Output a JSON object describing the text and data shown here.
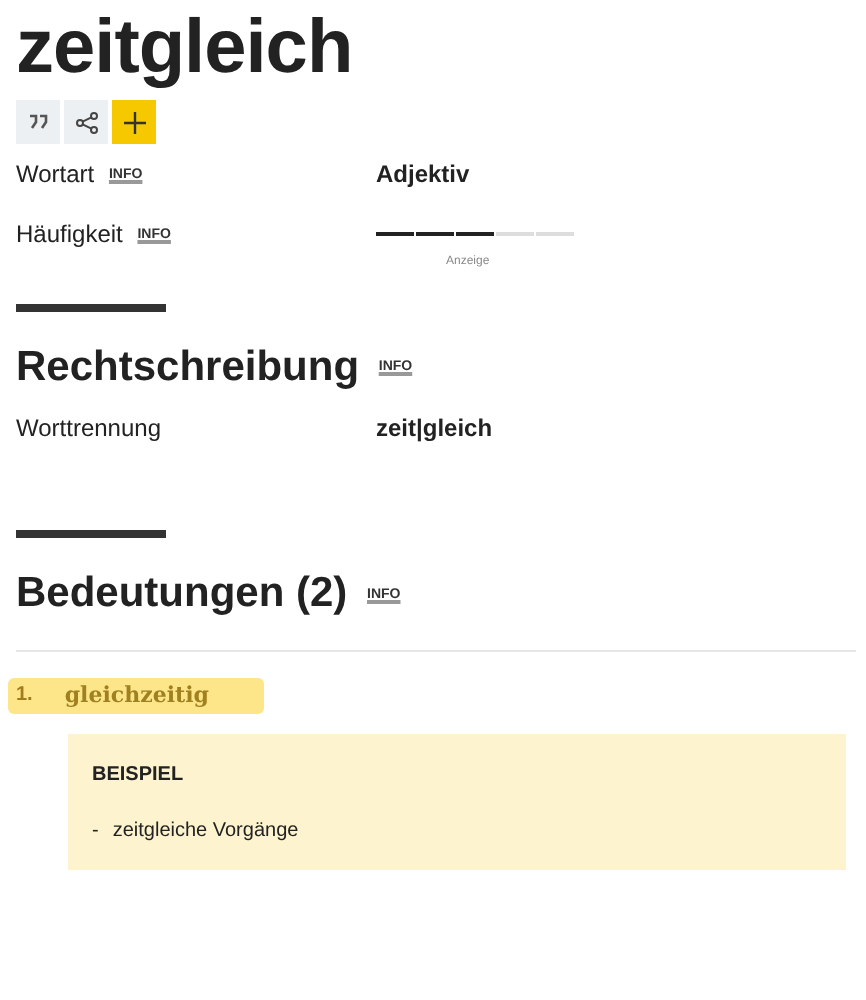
{
  "title": "zeitgleich",
  "actions": [
    {
      "kind": "quote"
    },
    {
      "kind": "share"
    },
    {
      "kind": "add"
    }
  ],
  "properties": [
    {
      "label": "Wortart",
      "info": "INFO",
      "value": "Adjektiv",
      "kind": "text"
    },
    {
      "label": "Häufigkeit",
      "info": "INFO",
      "level": 0.6,
      "kind": "meter"
    }
  ],
  "ad_label": "Anzeige",
  "spelling": {
    "heading": "Rechtschreibung",
    "info": "INFO",
    "rows": [
      {
        "label": "Worttrennung",
        "value": "zeit|gleich"
      }
    ]
  },
  "meanings": {
    "heading": "Bedeutungen (2)",
    "info": "INFO",
    "items": [
      {
        "number": "1.",
        "text": "gleichzeitig",
        "highlighted": true,
        "example_heading": "BEISPIEL",
        "examples": [
          {
            "bullet": "-",
            "text": "zeitgleiche Vorgänge"
          }
        ]
      }
    ]
  }
}
